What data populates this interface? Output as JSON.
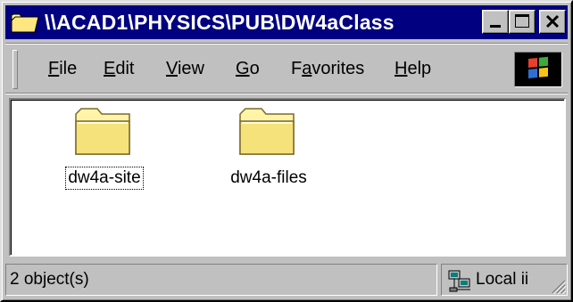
{
  "window": {
    "title": "\\\\ACAD1\\PHYSICS\\PUB\\DW4aClass",
    "title_icon": "folder-icon",
    "caption_buttons": [
      "minimize-icon",
      "maximize-icon",
      "close-icon"
    ],
    "colors": {
      "titlebar": "#000080",
      "face": "#c0c0c0",
      "content": "#ffffff"
    }
  },
  "menu": {
    "items": [
      {
        "hot": "F",
        "rest": "ile"
      },
      {
        "hot": "E",
        "rest": "dit"
      },
      {
        "hot": "V",
        "rest": "iew"
      },
      {
        "hot": "G",
        "rest": "o"
      },
      {
        "pre": "F",
        "hot": "a",
        "rest": "vorites"
      },
      {
        "hot": "H",
        "rest": "elp"
      }
    ],
    "brand_icon": "windows-logo-icon"
  },
  "content": {
    "items": [
      {
        "name": "dw4a-site",
        "icon": "folder-icon",
        "focused": true
      },
      {
        "name": "dw4a-files",
        "icon": "folder-icon",
        "focused": false
      }
    ]
  },
  "status": {
    "left": "2 object(s)",
    "zone_label": "Local ii",
    "zone_icon": "local-intranet-icon"
  }
}
